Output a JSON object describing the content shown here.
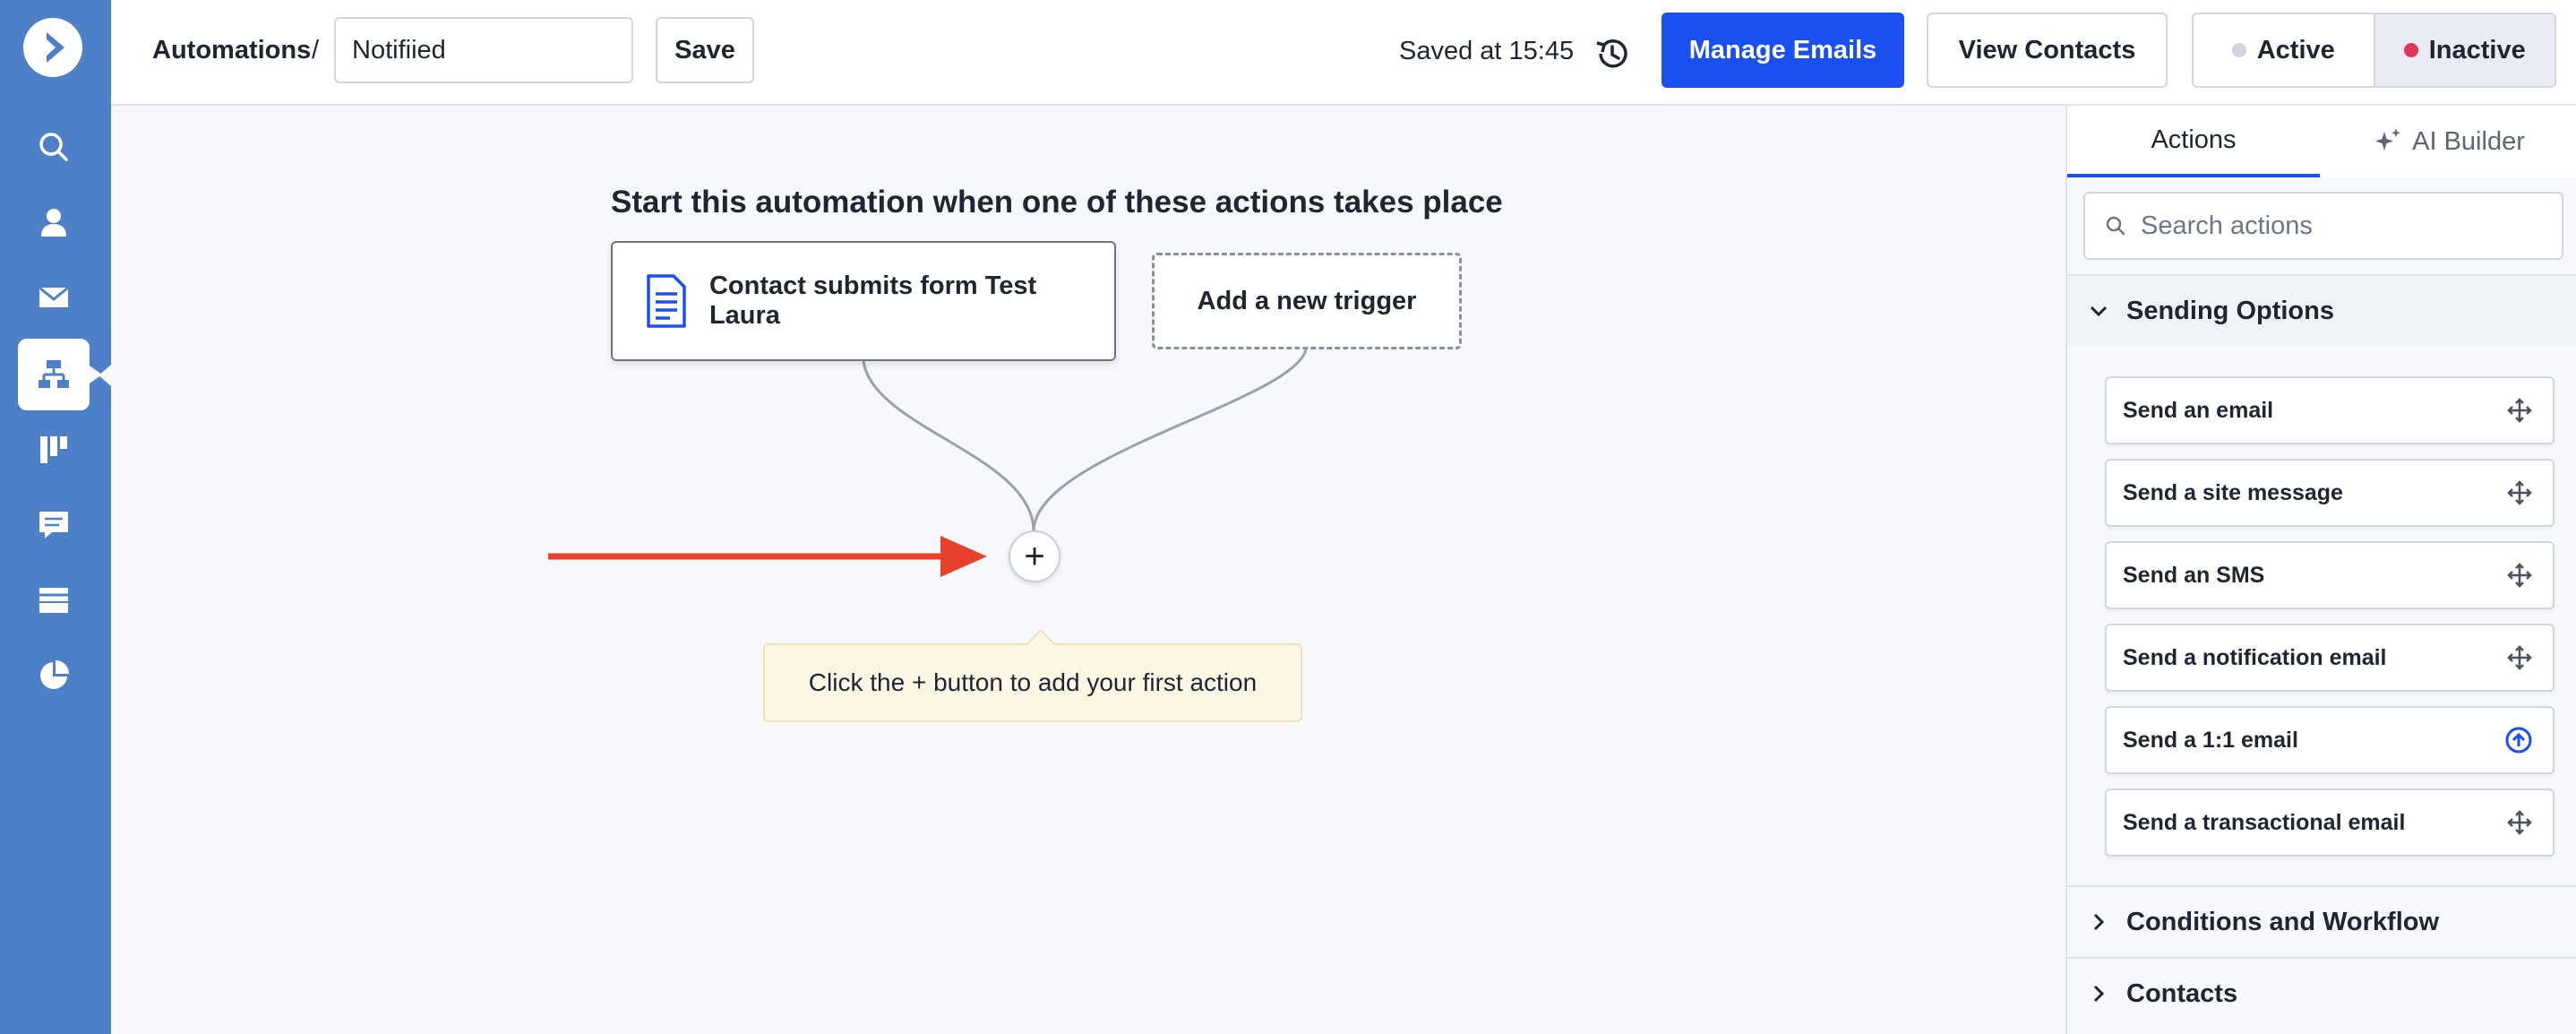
{
  "header": {
    "breadcrumb": "Automations",
    "separator": "/",
    "automation_name": "Notifiied",
    "save_label": "Save",
    "saved_at": "Saved at 15:45",
    "manage_emails_label": "Manage Emails",
    "view_contacts_label": "View Contacts",
    "status_toggle": {
      "active_label": "Active",
      "inactive_label": "Inactive",
      "selected": "Inactive"
    }
  },
  "sidebar": {
    "items": [
      {
        "icon": "search-icon"
      },
      {
        "icon": "contacts-icon"
      },
      {
        "icon": "campaigns-icon"
      },
      {
        "icon": "automations-icon",
        "active": true
      },
      {
        "icon": "deals-icon"
      },
      {
        "icon": "conversations-icon"
      },
      {
        "icon": "website-icon"
      },
      {
        "icon": "reports-icon"
      }
    ]
  },
  "canvas": {
    "title": "Start this automation when one of these actions takes place",
    "trigger_label": "Contact submits form Test Laura",
    "add_trigger_label": "Add a new trigger",
    "plus_label": "+",
    "hint": "Click the + button to add your first action"
  },
  "panel": {
    "tabs": {
      "actions": "Actions",
      "ai_builder": "AI Builder"
    },
    "search_placeholder": "Search actions",
    "sections": {
      "sending_options": "Sending Options",
      "conditions_workflow": "Conditions and Workflow",
      "contacts": "Contacts"
    },
    "actions": [
      {
        "label": "Send an email",
        "icon": "move-icon"
      },
      {
        "label": "Send a site message",
        "icon": "move-icon"
      },
      {
        "label": "Send an SMS",
        "icon": "move-icon"
      },
      {
        "label": "Send a notification email",
        "icon": "move-icon"
      },
      {
        "label": "Send a 1:1 email",
        "icon": "upgrade-icon"
      },
      {
        "label": "Send a transactional email",
        "icon": "move-icon"
      }
    ]
  },
  "colors": {
    "sidebar": "#4e80c7",
    "primary": "#1a4ff2",
    "arrow": "#e8402a",
    "inactive_dot": "#e0365a",
    "active_dot": "#d0d4dc"
  }
}
